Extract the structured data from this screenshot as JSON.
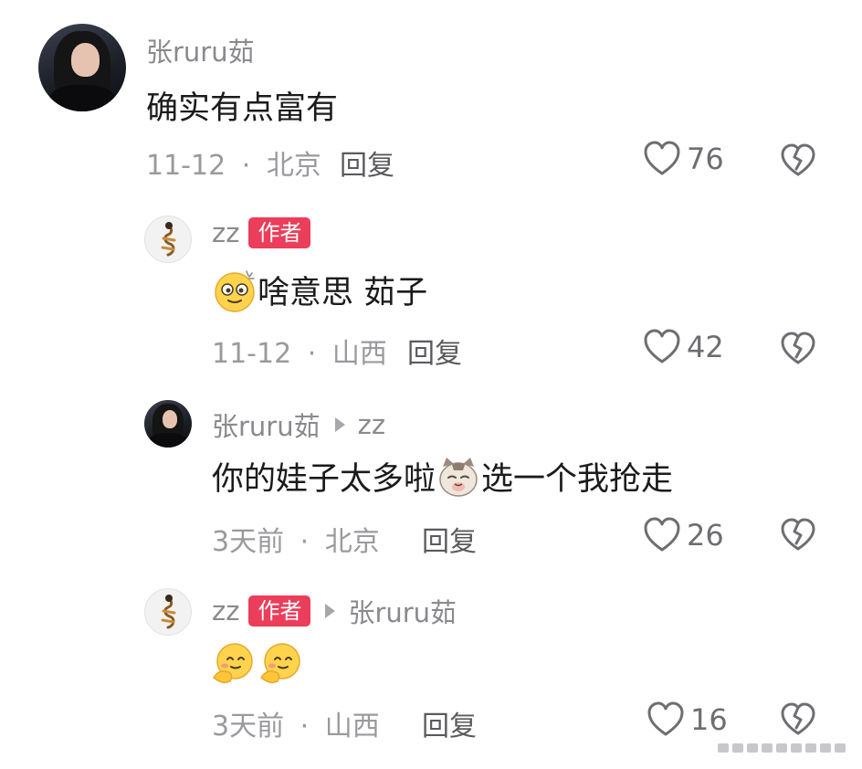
{
  "comments": [
    {
      "user": "张ruru茹",
      "text": "确实有点富有",
      "date": "11-12",
      "sep": "·",
      "location": "北京",
      "reply": "回复",
      "likes": "76"
    },
    {
      "user": "zz",
      "badge": "作者",
      "text": "啥意思 茹子",
      "emoji": "dizzy-face-emoji",
      "date": "11-12",
      "sep": "·",
      "location": "山西",
      "reply": "回复",
      "likes": "42"
    },
    {
      "user": "张ruru茹",
      "reply_to": "zz",
      "text_before": "你的娃子太多啦",
      "text_after": " 选一个我抢走",
      "emoji": "cat-face-emoji",
      "date": "3天前",
      "sep": "·",
      "location": "北京",
      "reply": "回复",
      "likes": "26"
    },
    {
      "user": "zz",
      "badge": "作者",
      "reply_to": "张ruru茹",
      "emoji": "shy-smile-emoji",
      "date": "3天前",
      "sep": "·",
      "location": "山西",
      "reply": "回复",
      "likes": "16"
    }
  ],
  "colors": {
    "badge": "#ec3d5a",
    "meta": "#9a9a9e",
    "username": "#8a8a8e"
  }
}
